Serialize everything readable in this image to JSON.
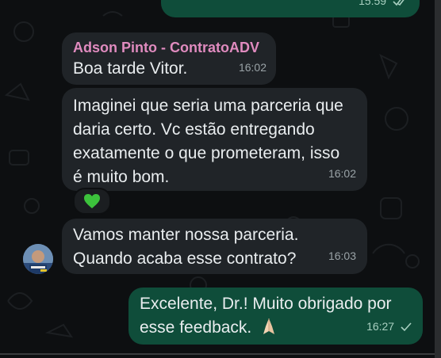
{
  "messages": [
    {
      "time": "15:59"
    },
    {
      "sender": "Adson Pinto - ContratoADV",
      "text": "Boa tarde Vitor.",
      "time": "16:02"
    },
    {
      "lines": [
        "Imaginei que seria uma parceria que",
        "daria certo. Vc estão entregando",
        "exatamente o que prometeram, isso",
        "é muito bom."
      ],
      "time": "16:02",
      "reaction": "green-heart"
    },
    {
      "lines": [
        "Vamos manter nossa parceria.",
        "Quando acaba esse contrato?"
      ],
      "time": "16:03"
    },
    {
      "lines": [
        "Excelente, Dr.! Muito obrigado por",
        "esse feedback."
      ],
      "emoji": "folded-hands",
      "time": "16:27"
    }
  ],
  "icons": {
    "read_receipt": "double-check-icon",
    "sent_receipt": "single-check-icon",
    "reaction": "green-heart-icon",
    "emoji": "folded-hands-icon",
    "avatar": "contact-avatar"
  },
  "colors": {
    "background": "#0d0f11",
    "incoming_bubble": "#202428",
    "outgoing_bubble": "#0f4d3a",
    "sender_name": "#e08bbf",
    "text": "#e9edef",
    "reaction_heart": "#3cc23c"
  }
}
